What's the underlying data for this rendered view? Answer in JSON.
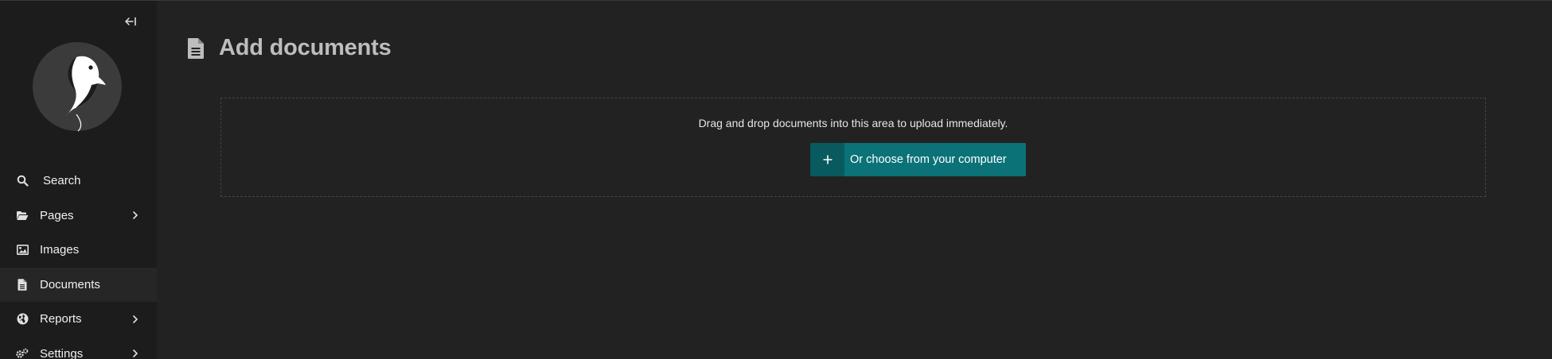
{
  "sidebar": {
    "collapse_icon": "collapse-sidebar-icon",
    "logo_icon": "wagtail-bird-logo",
    "items": [
      {
        "label": "Search",
        "icon": "search-icon",
        "has_submenu": false,
        "active": false
      },
      {
        "label": "Pages",
        "icon": "folder-open-icon",
        "has_submenu": true,
        "active": false
      },
      {
        "label": "Images",
        "icon": "image-icon",
        "has_submenu": false,
        "active": false
      },
      {
        "label": "Documents",
        "icon": "document-icon",
        "has_submenu": false,
        "active": true
      },
      {
        "label": "Reports",
        "icon": "globe-icon",
        "has_submenu": true,
        "active": false
      },
      {
        "label": "Settings",
        "icon": "cogs-icon",
        "has_submenu": true,
        "active": false
      }
    ]
  },
  "header": {
    "icon": "document-icon",
    "title": "Add documents"
  },
  "dropzone": {
    "text": "Drag and drop documents into this area to upload immediately.",
    "button_label": "Or choose from your computer",
    "button_icon": "plus-icon"
  },
  "colors": {
    "background": "#222222",
    "sidebar": "#1c1c1c",
    "accent": "#0b7277",
    "accent_dark": "#085a5e"
  }
}
